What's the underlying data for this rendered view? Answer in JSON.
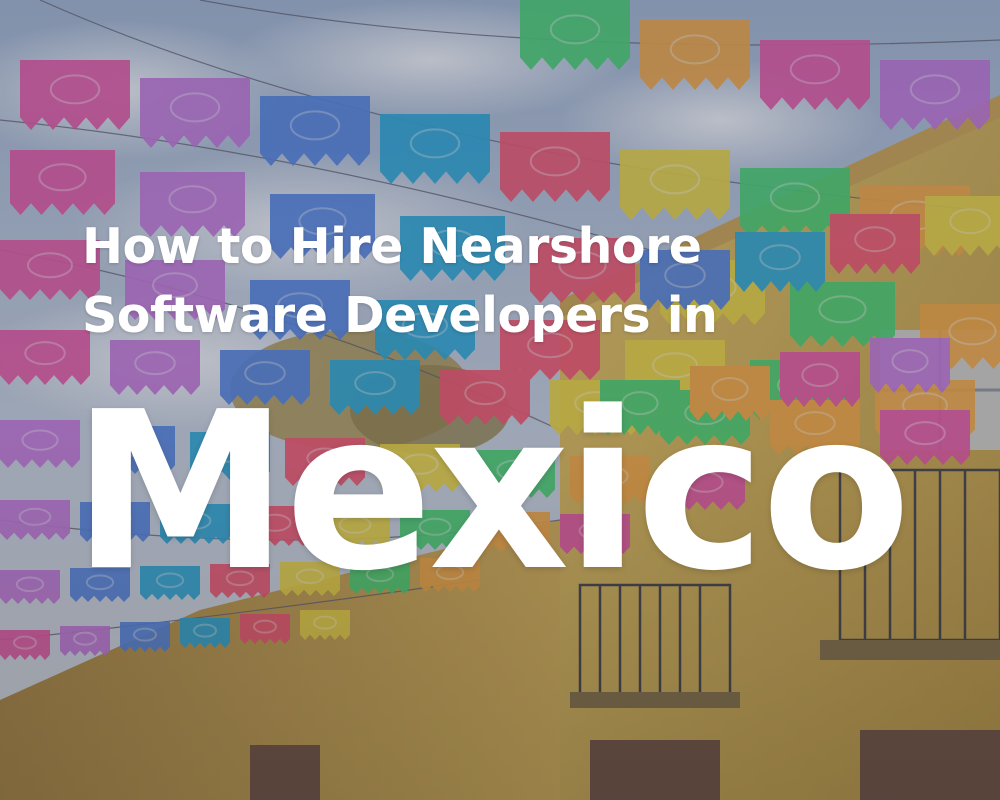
{
  "hero": {
    "title_line_1": "How to Hire Nearshore",
    "title_line_2": "Software Developers in",
    "big_word": "Mexico"
  },
  "background": {
    "description_colors": {
      "sky": "#aebfd6",
      "wall": "#d9b24a",
      "overlay": "#4a4f66"
    },
    "flag_colors": [
      "#e34fa1",
      "#1fa4d6",
      "#3fcf6b",
      "#c071d9",
      "#f04d6a",
      "#f2a33a",
      "#4b7fe0",
      "#e8d23a"
    ]
  }
}
